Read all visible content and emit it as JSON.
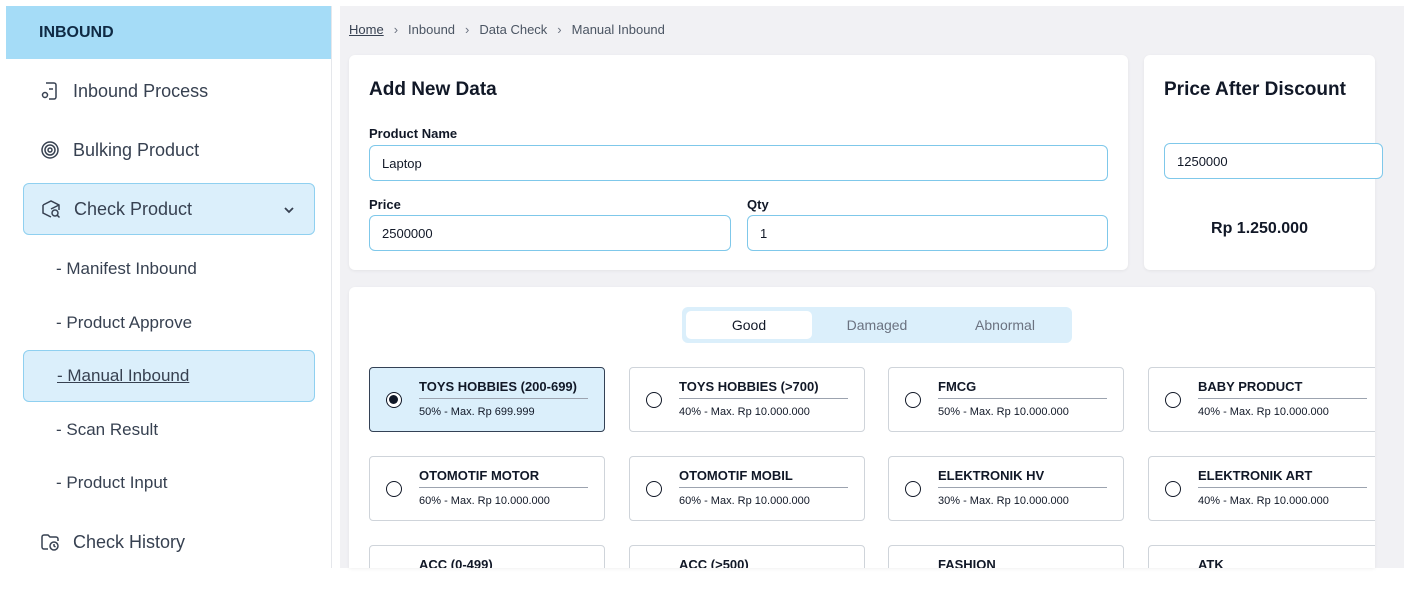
{
  "sidebar": {
    "header": "INBOUND",
    "items": [
      {
        "label": "Inbound Process",
        "icon": "inbound-process-icon"
      },
      {
        "label": "Bulking Product",
        "icon": "bulking-icon"
      },
      {
        "label": "Check Product",
        "icon": "check-product-icon"
      }
    ],
    "sub_items": [
      "- Manifest Inbound",
      "- Product Approve",
      "- Manual Inbound",
      "- Scan Result",
      "- Product Input"
    ],
    "history": {
      "label": "Check History",
      "icon": "check-history-icon"
    }
  },
  "breadcrumb": [
    "Home",
    "Inbound",
    "Data Check",
    "Manual Inbound"
  ],
  "add_form": {
    "title": "Add New Data",
    "product_name_label": "Product Name",
    "product_name_value": "Laptop",
    "price_label": "Price",
    "price_value": "2500000",
    "qty_label": "Qty",
    "qty_value": "1"
  },
  "price_card": {
    "title": "Price After Discount",
    "value": "1250000",
    "formatted": "Rp 1.250.000"
  },
  "tabs": [
    "Good",
    "Damaged",
    "Abnormal"
  ],
  "categories": [
    {
      "name": "TOYS HOBBIES (200-699)",
      "desc": "50% - Max. Rp 699.999",
      "selected": true
    },
    {
      "name": "TOYS HOBBIES (>700)",
      "desc": "40% - Max. Rp 10.000.000",
      "selected": false
    },
    {
      "name": "FMCG",
      "desc": "50% - Max. Rp 10.000.000",
      "selected": false
    },
    {
      "name": "BABY PRODUCT",
      "desc": "40% - Max. Rp 10.000.000",
      "selected": false
    },
    {
      "name": "OTOMOTIF MOTOR",
      "desc": "60% - Max. Rp 10.000.000",
      "selected": false
    },
    {
      "name": "OTOMOTIF MOBIL",
      "desc": "60% - Max. Rp 10.000.000",
      "selected": false
    },
    {
      "name": "ELEKTRONIK HV",
      "desc": "30% - Max. Rp 10.000.000",
      "selected": false
    },
    {
      "name": "ELEKTRONIK ART",
      "desc": "40% - Max. Rp 10.000.000",
      "selected": false
    },
    {
      "name": "ACC (0-499)",
      "desc": "",
      "selected": false
    },
    {
      "name": "ACC (>500)",
      "desc": "",
      "selected": false
    },
    {
      "name": "FASHION",
      "desc": "",
      "selected": false
    },
    {
      "name": "ATK",
      "desc": "",
      "selected": false
    }
  ],
  "colors": {
    "accent": "#a5dcf7",
    "active_bg": "#dbeffb",
    "border": "#8fd0f0"
  }
}
